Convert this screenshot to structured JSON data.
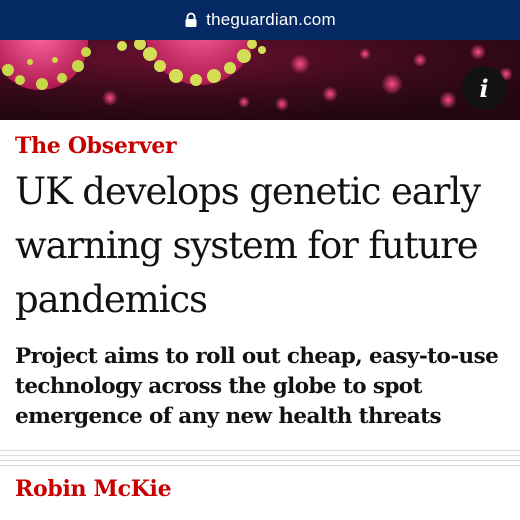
{
  "browser": {
    "url": "theguardian.com",
    "lock_icon": "lock-icon"
  },
  "hero": {
    "info_button_label": "i",
    "colors": {
      "background": "#3a0a1a",
      "virus_pink": "#e0306e",
      "virus_yellow": "#c8d84a"
    }
  },
  "article": {
    "section": "The Observer",
    "headline": "UK develops genetic early warning system for future pandemics",
    "standfirst": "Project aims to roll out cheap, easy-to-use technology across the globe to spot emergence of any new health threats",
    "byline": "Robin McKie"
  },
  "colors": {
    "url_bar": "#052962",
    "accent_red": "#c70000",
    "text": "#121212"
  }
}
